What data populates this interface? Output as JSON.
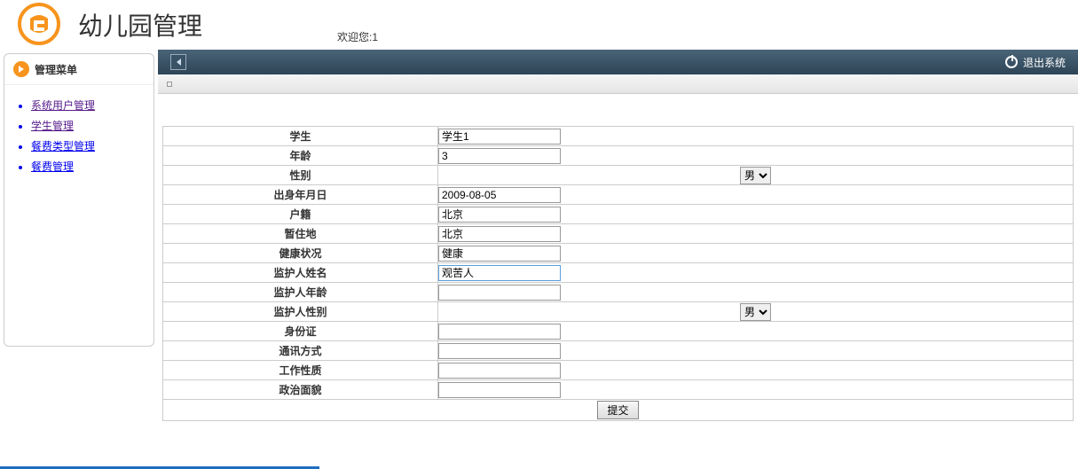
{
  "header": {
    "app_title": "幼儿园管理",
    "welcome_prefix": "欢迎您:",
    "welcome_user": "1"
  },
  "sidebar": {
    "title": "管理菜单",
    "items": [
      {
        "label": "系统用户管理",
        "visited": true
      },
      {
        "label": "学生管理",
        "visited": true
      },
      {
        "label": "餐费类型管理",
        "visited": false
      },
      {
        "label": "餐费管理",
        "visited": false
      }
    ]
  },
  "toolbar": {
    "logout_label": "退出系统"
  },
  "form": {
    "rows": [
      {
        "label": "学生",
        "type": "text",
        "value": "学生1"
      },
      {
        "label": "年龄",
        "type": "text",
        "value": "3"
      },
      {
        "label": "性别",
        "type": "select",
        "value": "男",
        "center": true
      },
      {
        "label": "出身年月日",
        "type": "text",
        "value": "2009-08-05"
      },
      {
        "label": "户籍",
        "type": "text",
        "value": "北京"
      },
      {
        "label": "暂住地",
        "type": "text",
        "value": "北京"
      },
      {
        "label": "健康状况",
        "type": "text",
        "value": "健康"
      },
      {
        "label": "监护人姓名",
        "type": "text",
        "value": "观苦人",
        "active": true
      },
      {
        "label": "监护人年龄",
        "type": "text",
        "value": ""
      },
      {
        "label": "监护人性别",
        "type": "select",
        "value": "男",
        "center": true
      },
      {
        "label": "身份证",
        "type": "text",
        "value": ""
      },
      {
        "label": "通讯方式",
        "type": "text",
        "value": ""
      },
      {
        "label": "工作性质",
        "type": "text",
        "value": ""
      },
      {
        "label": "政治面貌",
        "type": "text",
        "value": ""
      }
    ],
    "submit_label": "提交"
  }
}
